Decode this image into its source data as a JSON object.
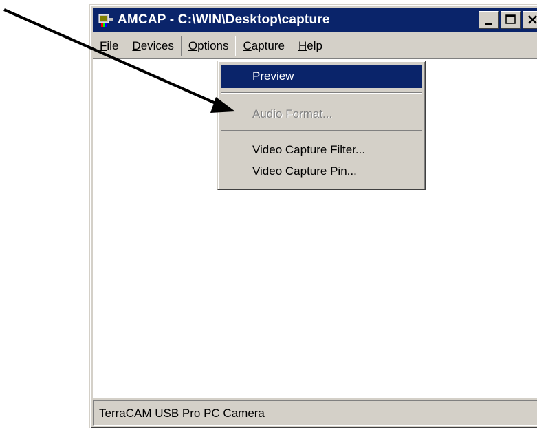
{
  "window": {
    "title": "AMCAP - C:\\WIN\\Desktop\\capture",
    "buttons": {
      "minimize_icon": "minimize-icon",
      "maximize_icon": "maximize-icon",
      "close_icon": "close-icon"
    }
  },
  "menubar": {
    "file": {
      "first": "F",
      "rest": "ile"
    },
    "devices": {
      "first": "D",
      "rest": "evices"
    },
    "options": {
      "first": "O",
      "rest": "ptions"
    },
    "capture": {
      "first": "C",
      "rest": "apture"
    },
    "help": {
      "first": "H",
      "rest": "elp"
    }
  },
  "options_menu": {
    "items": [
      {
        "label": "Preview",
        "state": "highlighted"
      },
      {
        "label": "Audio Format...",
        "state": "disabled"
      },
      {
        "label": "Video Capture Filter...",
        "state": "enabled"
      },
      {
        "label": "Video Capture Pin...",
        "state": "enabled"
      }
    ]
  },
  "statusbar": {
    "text": "TerraCAM USB Pro PC Camera"
  },
  "colors": {
    "titlebar": "#0a246a",
    "highlight": "#0a246a",
    "face": "#d4d0c8",
    "client": "#ffffff"
  }
}
